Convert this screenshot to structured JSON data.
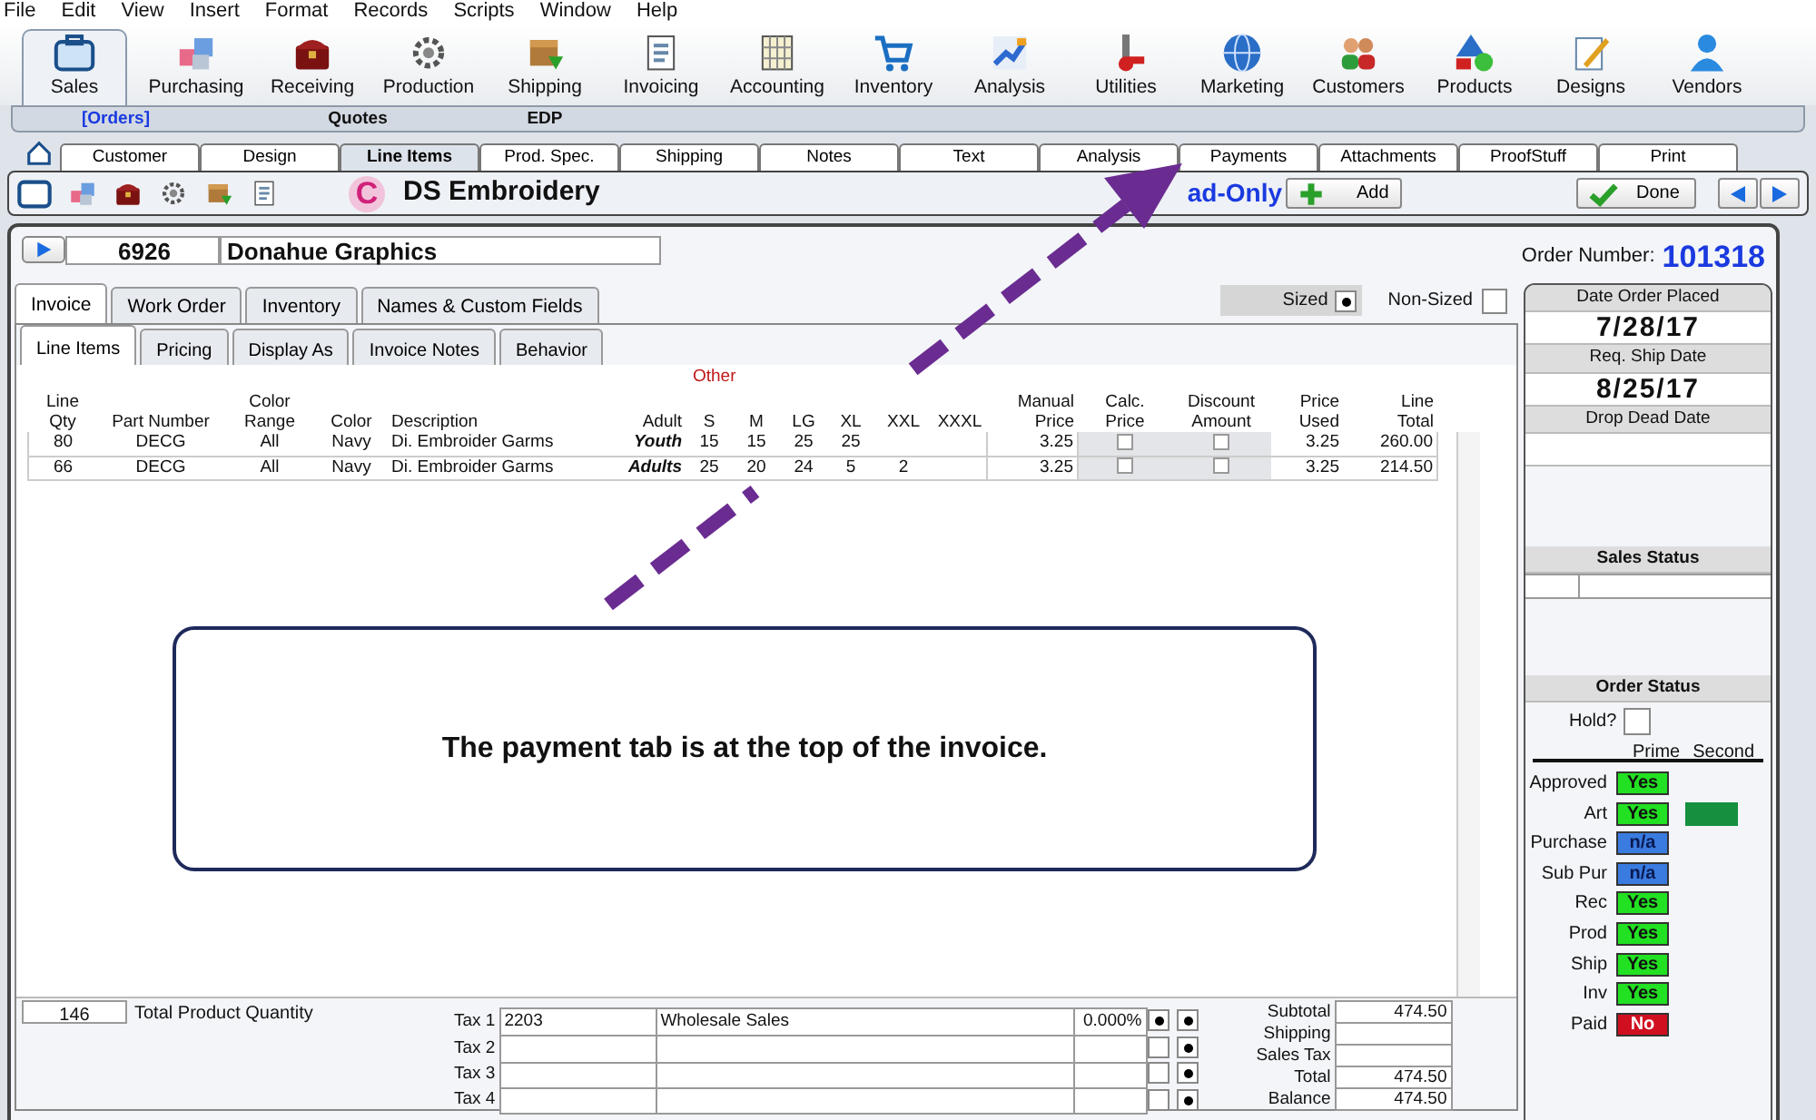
{
  "menu": [
    "File",
    "Edit",
    "View",
    "Insert",
    "Format",
    "Records",
    "Scripts",
    "Window",
    "Help"
  ],
  "modules": [
    {
      "label": "Sales",
      "selected": true
    },
    {
      "label": "Purchasing",
      "selected": false
    },
    {
      "label": "Receiving",
      "selected": false
    },
    {
      "label": "Production",
      "selected": false
    },
    {
      "label": "Shipping",
      "selected": false
    },
    {
      "label": "Invoicing",
      "selected": false
    },
    {
      "label": "Accounting",
      "selected": false
    },
    {
      "label": "Inventory",
      "selected": false
    },
    {
      "label": "Analysis",
      "selected": false
    },
    {
      "label": "Utilities",
      "selected": false
    },
    {
      "label": "Marketing",
      "selected": false
    },
    {
      "label": "Customers",
      "selected": false
    },
    {
      "label": "Products",
      "selected": false
    },
    {
      "label": "Designs",
      "selected": false
    },
    {
      "label": "Vendors",
      "selected": false
    }
  ],
  "subnav": [
    {
      "label": "[Orders]",
      "selected": true
    },
    {
      "label": "Quotes",
      "selected": false
    },
    {
      "label": "EDP",
      "selected": false
    }
  ],
  "record_tabs": [
    {
      "label": "Customer",
      "selected": false
    },
    {
      "label": "Design",
      "selected": false
    },
    {
      "label": "Line Items",
      "selected": true
    },
    {
      "label": "Prod. Spec.",
      "selected": false
    },
    {
      "label": "Shipping",
      "selected": false
    },
    {
      "label": "Notes",
      "selected": false
    },
    {
      "label": "Text",
      "selected": false
    },
    {
      "label": "Analysis",
      "selected": false
    },
    {
      "label": "Payments",
      "selected": false
    },
    {
      "label": "Attachments",
      "selected": false
    },
    {
      "label": "ProofStuff",
      "selected": false
    },
    {
      "label": "Print",
      "selected": false
    }
  ],
  "toolbar": {
    "logo": "C",
    "company": "DS Embroidery",
    "mode": "ad-Only",
    "add": "Add",
    "done": "Done"
  },
  "order": {
    "id": "6926",
    "customer": "Donahue Graphics",
    "number_label": "Order Number:",
    "number": "101318"
  },
  "invoice_tabs": [
    {
      "label": "Invoice",
      "selected": true
    },
    {
      "label": "Work Order",
      "selected": false
    },
    {
      "label": "Inventory",
      "selected": false
    },
    {
      "label": "Names & Custom Fields",
      "selected": false
    }
  ],
  "sized": {
    "label": "Sized",
    "selected": true
  },
  "non_sized": {
    "label": "Non-Sized",
    "checked": false
  },
  "sub_tabs": [
    {
      "label": "Line Items",
      "selected": true
    },
    {
      "label": "Pricing",
      "selected": false
    },
    {
      "label": "Display As",
      "selected": false
    },
    {
      "label": "Invoice Notes",
      "selected": false
    },
    {
      "label": "Behavior",
      "selected": false
    }
  ],
  "table": {
    "other_label": "Other",
    "columns": [
      "Line\nQty",
      "Part Number",
      "Color\nRange",
      "Color",
      "Description",
      "Adult",
      "S",
      "M",
      "LG",
      "XL",
      "XXL",
      "XXXL",
      "Manual\nPrice",
      "Calc.\nPrice",
      "Discount\nAmount",
      "Price\nUsed",
      "Line\nTotal"
    ],
    "rows": [
      {
        "qty": "80",
        "part": "DECG",
        "range": "All",
        "garment_color": "Navy",
        "description": "Di. Embroider Garms",
        "adult": "Youth",
        "s": "15",
        "m": "15",
        "lg": "25",
        "xl": "25",
        "manual_price": "3.25",
        "calc_price": false,
        "discount": false,
        "price_used": "3.25",
        "line_total": "260.00"
      },
      {
        "qty": "66",
        "part": "DECG",
        "range": "All",
        "garment_color": "Navy",
        "description": "Di. Embroider Garms",
        "adult": "Adults",
        "s": "25",
        "m": "20",
        "lg": "24",
        "xl": "5",
        "xxl": "2",
        "manual_price": "3.25",
        "calc_price": false,
        "discount": false,
        "price_used": "3.25",
        "line_total": "214.50"
      }
    ]
  },
  "footer": {
    "total_qty": "146",
    "total_qty_label": "Total Product Quantity",
    "taxes": [
      {
        "label": "Tax 1",
        "code": "2203",
        "description": "Wholesale Sales",
        "rate": "0.000%",
        "flag_a": true,
        "flag_b": true
      },
      {
        "label": "Tax 2",
        "flag_a": false,
        "flag_b": true
      },
      {
        "label": "Tax 3",
        "flag_a": false,
        "flag_b": true
      },
      {
        "label": "Tax 4",
        "flag_a": false,
        "flag_b": true
      }
    ],
    "totals": [
      {
        "label": "Subtotal",
        "value": "474.50"
      },
      {
        "label": "Shipping"
      },
      {
        "label": "Sales Tax"
      },
      {
        "label": "Total",
        "value": "474.50"
      },
      {
        "label": "Balance",
        "value": "474.50"
      }
    ]
  },
  "side": {
    "dates": [
      {
        "label": "Date Order Placed",
        "value": "7/28/17"
      },
      {
        "label": "Req. Ship Date",
        "value": "8/25/17"
      },
      {
        "label": "Drop Dead Date"
      }
    ],
    "sales_status_title": "Sales Status",
    "order_status_title": "Order Status",
    "hold": {
      "label": "Hold?",
      "checked": false
    },
    "columns": [
      "Prime",
      "Second"
    ],
    "statuses": [
      {
        "label": "Approved",
        "value": "Yes",
        "color": "#22e022"
      },
      {
        "label": "Art",
        "value": "Yes",
        "color": "#22e022",
        "second": {
          "color": "#16903f"
        }
      },
      {
        "label": "Purchase",
        "value": "n/a",
        "color": "#3a7be0"
      },
      {
        "label": "Sub Pur",
        "value": "n/a",
        "color": "#3a7be0"
      },
      {
        "label": "Rec",
        "value": "Yes",
        "color": "#22e022"
      },
      {
        "label": "Prod",
        "value": "Yes",
        "color": "#22e022"
      },
      {
        "label": "Ship",
        "value": "Yes",
        "color": "#22e022"
      },
      {
        "label": "Inv",
        "value": "Yes",
        "color": "#22e022"
      },
      {
        "label": "Paid",
        "value": "No",
        "color": "#d01020"
      }
    ]
  },
  "callout": {
    "text": "The payment tab is at the top of the invoice."
  }
}
